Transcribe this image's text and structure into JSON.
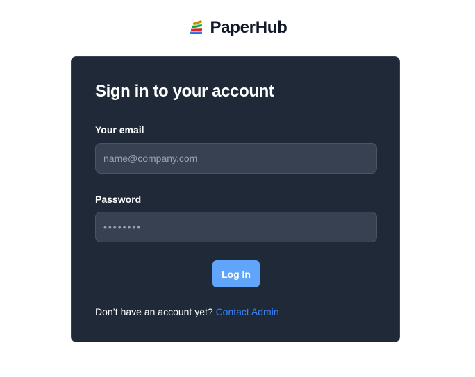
{
  "brand": {
    "name": "PaperHub",
    "logo_icon": "books-icon"
  },
  "login": {
    "title": "Sign in to your account",
    "email_label": "Your email",
    "email_placeholder": "name@company.com",
    "password_label": "Password",
    "password_placeholder": "••••••••",
    "submit_label": "Log In",
    "signup_prompt": "Don’t have an account yet?",
    "contact_link": "Contact Admin"
  },
  "colors": {
    "card_background": "#1f2937",
    "input_background": "#374151",
    "button": "#60a5fa",
    "link": "#3b82f6"
  }
}
